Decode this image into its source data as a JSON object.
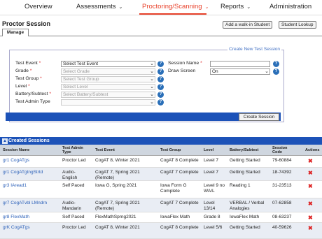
{
  "nav": {
    "items": [
      {
        "label": "Overview"
      },
      {
        "label": "Assessments",
        "chevron": true
      },
      {
        "label": "Proctoring/Scanning",
        "chevron": true,
        "active": true
      },
      {
        "label": "Reports",
        "chevron": true
      },
      {
        "label": "Administration"
      }
    ]
  },
  "header": {
    "title": "Proctor Session",
    "subtab": "Manage",
    "walkin_button": "Add a walk-in Student",
    "lookup_button": "Student Lookup"
  },
  "new_session": {
    "legend": "Create New Test Session",
    "test_event_label": "Test Event",
    "test_event_value": "Select Test Event",
    "grade_label": "Grade",
    "grade_value": "Select Grade",
    "test_group_label": "Test Group",
    "test_group_value": "Select Test Group",
    "level_label": "Level",
    "level_value": "Select Level",
    "battery_label": "Battery/Subtest",
    "battery_value": "Select Battery/Subtest",
    "admin_type_label": "Test Admin Type",
    "admin_type_value": "",
    "session_name_label": "Session Name",
    "session_name_value": "",
    "draw_screen_label": "Draw Screen",
    "draw_screen_value": "On",
    "required_mark": "*",
    "help_glyph": "?",
    "create_button": "Create Session"
  },
  "sessions": {
    "title": "Created Sessions",
    "collapse_glyph": "▲",
    "columns": [
      "Session Name",
      "Test Admin Type",
      "Test Event",
      "Test Group",
      "Level",
      "Battery/Subtest",
      "Session Code",
      "Actions"
    ],
    "rows": [
      {
        "name": "gr1 CogATgs",
        "admin": "Proctor Led",
        "event": "CogAT 8, Winter 2021",
        "group": "CogAT 8 Complete",
        "level": "Level 7",
        "battery": "Getting Started",
        "code": "79-60884"
      },
      {
        "name": "gr1 CogATgtngStrtd",
        "admin": "Audio-English",
        "event": "CogAT 7, Spring 2021 (Remote)",
        "group": "CogAT 7 Complete",
        "level": "Level 7",
        "battery": "Getting Started",
        "code": "18-74392"
      },
      {
        "name": "gr3 IAread1",
        "admin": "Self Paced",
        "event": "Iowa G, Spring 2021",
        "group": "Iowa Form G Complete",
        "level": "Level 9 no WA/L",
        "battery": "Reading 1",
        "code": "31-23513"
      },
      {
        "name": "gr7 CogATvbl LMndrn",
        "admin": "Audio-Mandarin",
        "event": "CogAT 7, Spring 2021 (Remote)",
        "group": "CogAT 7 Complete",
        "level": "Level 13/14",
        "battery": "VERBAL / Verbal Analogies",
        "code": "07-62858"
      },
      {
        "name": "gr8 FlexMath",
        "admin": "Self Paced",
        "event": "FlexMathSprng2021",
        "group": "IowaFlex Math",
        "level": "Grade 8",
        "battery": "IowaFlex Math",
        "code": "08-63237"
      },
      {
        "name": "grK CogATgs",
        "admin": "Proctor Led",
        "event": "CogAT 8, Winter 2021",
        "group": "CogAT 8 Complete",
        "level": "Level 5/6",
        "battery": "Getting Started",
        "code": "40-59626"
      }
    ],
    "delete_glyph": "✖"
  }
}
